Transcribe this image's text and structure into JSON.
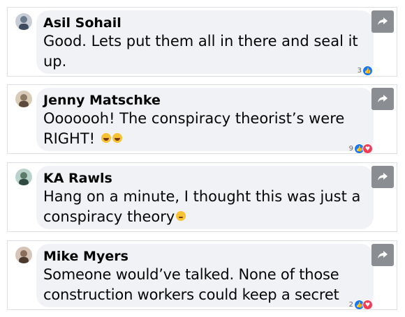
{
  "comments": [
    {
      "author": "Asil Sohail",
      "text": "Good. Lets put them all in there and seal it up.",
      "reactions": {
        "count": "3",
        "types": [
          "like"
        ]
      },
      "avatar_color": "#6a7b8c"
    },
    {
      "author": "Jenny Matschke",
      "text": "Ooooooh! The conspiracy theorist’s were RIGHT!",
      "emojis": [
        "laughing-emoji",
        "laughing-emoji"
      ],
      "reactions": {
        "count": "9",
        "types": [
          "like",
          "love"
        ]
      },
      "avatar_color": "#8c7b62"
    },
    {
      "author": "KA Rawls",
      "text": "Hang on a minute, I thought this was just a conspiracy theory",
      "emojis": [
        "winking-emoji"
      ],
      "reactions": {
        "count": "",
        "types": []
      },
      "avatar_color": "#5a7a6a"
    },
    {
      "author": "Mike Myers",
      "text": "Someone would’ve talked. None of those construction workers could keep a secret",
      "reactions": {
        "count": "2",
        "types": [
          "like",
          "love"
        ]
      },
      "avatar_color": "#8a6e5c"
    }
  ],
  "colors": {
    "bubble": "#f0f2f5",
    "like": "#1877f2",
    "love": "#f33e58",
    "share_button": "#8a8d91"
  }
}
